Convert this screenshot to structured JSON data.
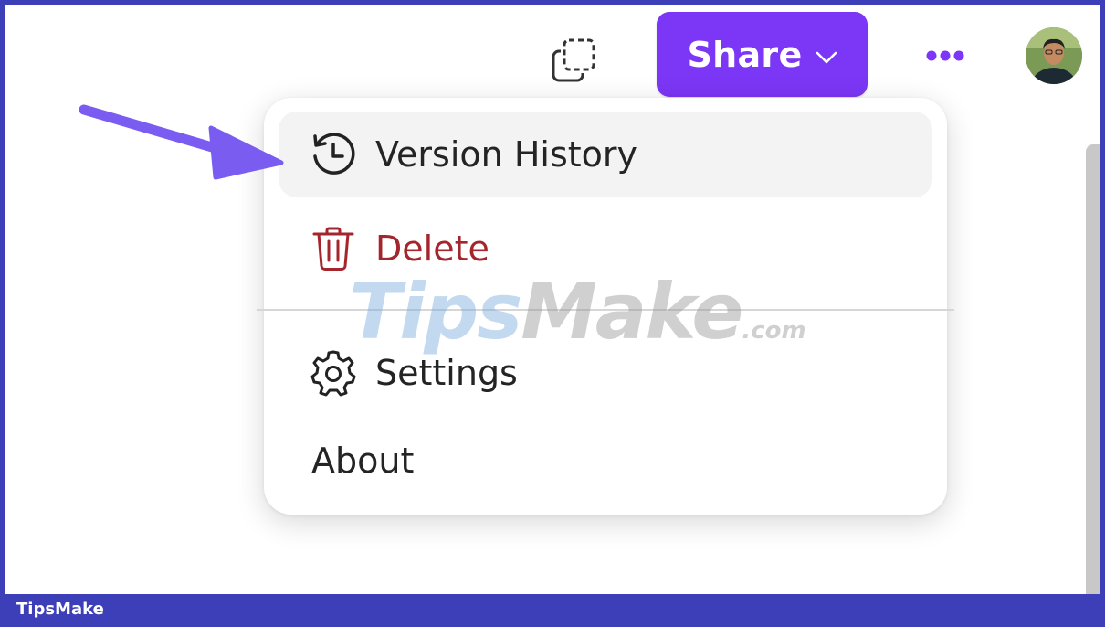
{
  "toolbar": {
    "share_label": "Share",
    "copy_icon": "copy-icon",
    "more_icon": "more-horizontal-icon",
    "avatar_icon": "user-avatar"
  },
  "menu": {
    "items": [
      {
        "label": "Version History",
        "icon": "history-icon"
      },
      {
        "label": "Delete",
        "icon": "trash-icon",
        "color": "#a4262c"
      },
      {
        "label": "Settings",
        "icon": "gear-icon"
      },
      {
        "label": "About",
        "icon": ""
      }
    ]
  },
  "watermark": {
    "part1": "Tips",
    "part2": "Make",
    "part3": ".com"
  },
  "footer": {
    "brand": "TipsMake"
  },
  "colors": {
    "accent": "#7c36f5",
    "frame": "#3d3fb8",
    "delete": "#a4262c",
    "annotation_arrow": "#7b5cf0"
  }
}
